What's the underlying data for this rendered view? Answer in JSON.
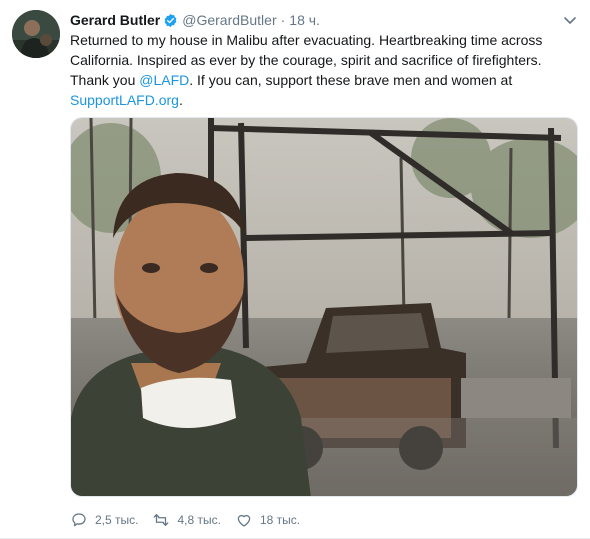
{
  "author": {
    "name": "Gerard Butler",
    "handle": "@GerardButler",
    "time": "18 ч.",
    "separator": "·"
  },
  "tweet": {
    "line1": "Returned to my house in Malibu after evacuating. Heartbreaking time across",
    "line2": "California. Inspired as ever by the courage, spirit and sacrifice of firefighters.",
    "line3_prefix": "Thank you ",
    "mention": "@LAFD",
    "line3_suffix": ". If you can, support these brave men and women at",
    "url": "SupportLAFD.org",
    "url_suffix": "."
  },
  "stats": {
    "replies": "2,5 тыс.",
    "retweets": "4,8 тыс.",
    "likes": "18 тыс."
  },
  "colors": {
    "accent": "#1b95e0",
    "verified": "#1da1f2",
    "muted": "#657786"
  },
  "icons": {
    "reply": "reply-icon",
    "retweet": "retweet-icon",
    "like": "heart-icon",
    "more": "chevron-down-icon",
    "verified": "verified-badge-icon"
  }
}
